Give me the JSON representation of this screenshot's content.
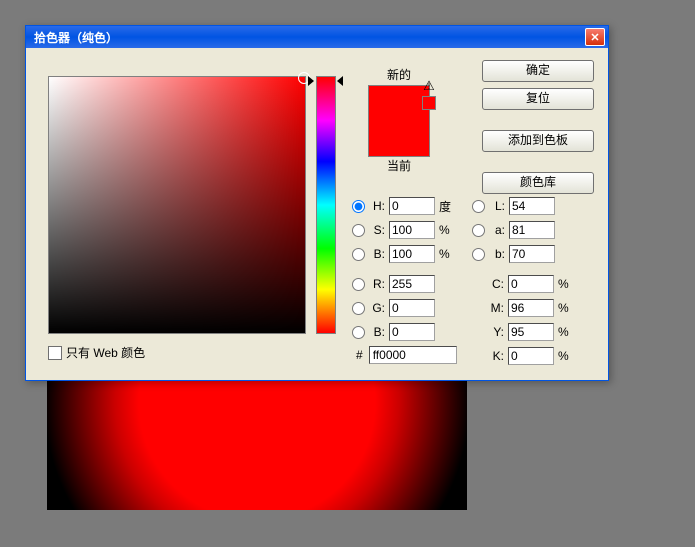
{
  "window": {
    "title": "拾色器（纯色）"
  },
  "buttons": {
    "ok": "确定",
    "reset": "复位",
    "add_swatch": "添加到色板",
    "color_libs": "颜色库"
  },
  "preview": {
    "new_label": "新的",
    "current_label": "当前"
  },
  "fields": {
    "H": {
      "label": "H:",
      "value": "0",
      "unit": "度"
    },
    "S": {
      "label": "S:",
      "value": "100",
      "unit": "%"
    },
    "Bv": {
      "label": "B:",
      "value": "100",
      "unit": "%"
    },
    "R": {
      "label": "R:",
      "value": "255",
      "unit": ""
    },
    "G": {
      "label": "G:",
      "value": "0",
      "unit": ""
    },
    "Bb": {
      "label": "B:",
      "value": "0",
      "unit": ""
    },
    "L": {
      "label": "L:",
      "value": "54",
      "unit": ""
    },
    "a": {
      "label": "a:",
      "value": "81",
      "unit": ""
    },
    "b": {
      "label": "b:",
      "value": "70",
      "unit": ""
    },
    "C": {
      "label": "C:",
      "value": "0",
      "unit": "%"
    },
    "M": {
      "label": "M:",
      "value": "96",
      "unit": "%"
    },
    "Y": {
      "label": "Y:",
      "value": "95",
      "unit": "%"
    },
    "K": {
      "label": "K:",
      "value": "0",
      "unit": "%"
    }
  },
  "hex": {
    "label": "#",
    "value": "ff0000"
  },
  "web_only": {
    "label": "只有 Web 颜色"
  },
  "colors": {
    "selected": "#ff0000"
  }
}
